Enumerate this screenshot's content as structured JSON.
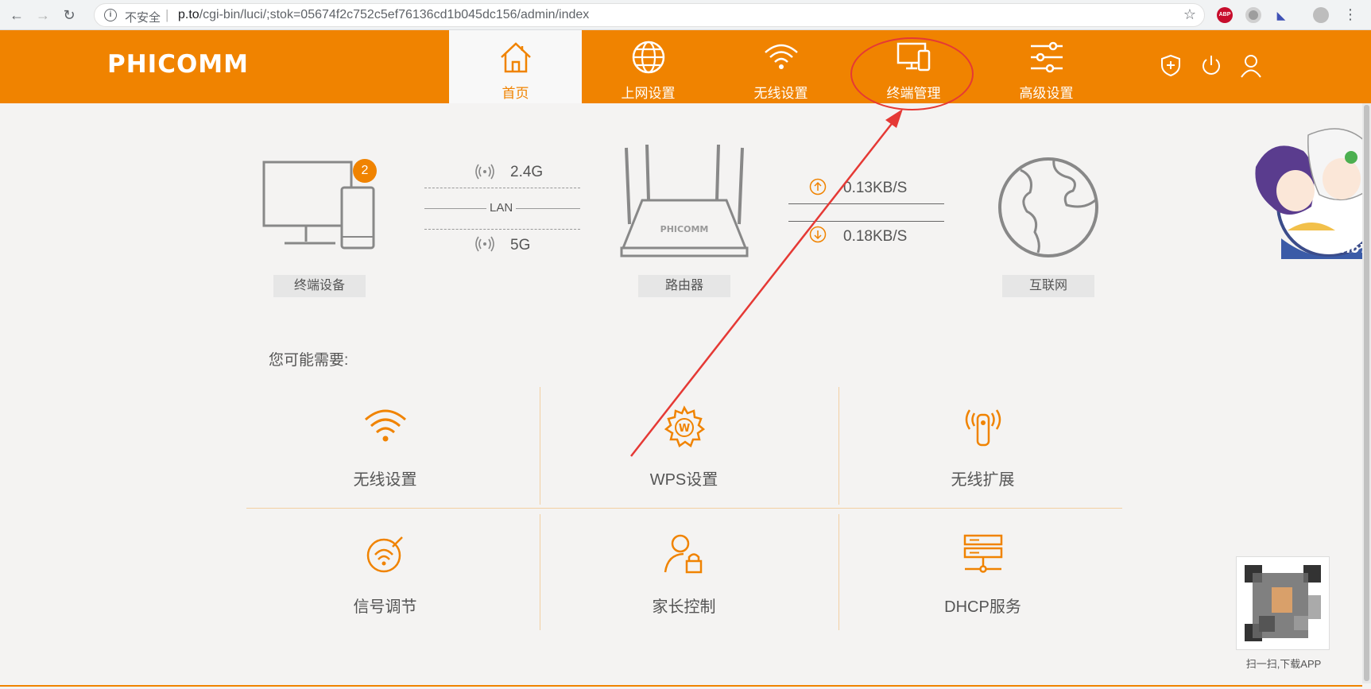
{
  "browser": {
    "security_label": "不安全",
    "url_host": "p.to",
    "url_path": "/cgi-bin/luci/;stok=05674f2c752c5ef76136cd1b045dc156/admin/index",
    "abp_label": "ABP"
  },
  "header": {
    "logo": "PHICOMM",
    "nav": [
      {
        "label": "首页",
        "icon": "home-icon",
        "active": true
      },
      {
        "label": "上网设置",
        "icon": "globe-icon"
      },
      {
        "label": "无线设置",
        "icon": "wifi-icon"
      },
      {
        "label": "终端管理",
        "icon": "devices-icon"
      },
      {
        "label": "高级设置",
        "icon": "sliders-icon"
      }
    ],
    "accent_color": "#f08300"
  },
  "status": {
    "device_badge": "2",
    "device_label": "终端设备",
    "band_24": "2.4G",
    "lan_label": "LAN",
    "band_5": "5G",
    "router_brand": "PHICOMM",
    "router_label": "路由器",
    "upload_speed": "0.13KB/S",
    "download_speed": "0.18KB/S",
    "internet_label": "互联网"
  },
  "suggest": {
    "title": "您可能需要:",
    "tiles": [
      {
        "label": "无线设置",
        "icon": "wifi-icon"
      },
      {
        "label": "WPS设置",
        "icon": "wps-gear-icon"
      },
      {
        "label": "无线扩展",
        "icon": "signal-tower-icon"
      },
      {
        "label": "信号调节",
        "icon": "signal-adjust-icon"
      },
      {
        "label": "家长控制",
        "icon": "parental-lock-icon"
      },
      {
        "label": "DHCP服务",
        "icon": "server-icon"
      }
    ]
  },
  "side": {
    "mascot_brand": "miHoYo",
    "qr_caption": "扫一扫,下载APP"
  }
}
